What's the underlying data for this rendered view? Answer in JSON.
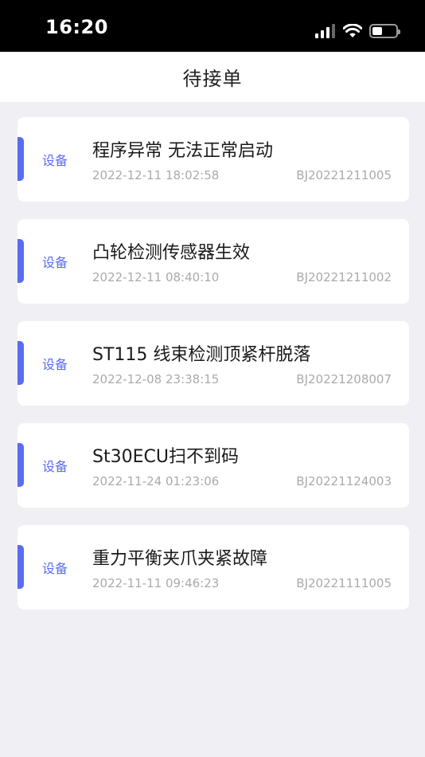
{
  "status_bar": {
    "time": "16:20"
  },
  "nav": {
    "title": "待接单"
  },
  "orders": [
    {
      "tag": "设备",
      "title": "程序异常 无法正常启动",
      "time": "2022-12-11 18:02:58",
      "code": "BJ20221211005"
    },
    {
      "tag": "设备",
      "title": "凸轮检测传感器生效",
      "time": "2022-12-11 08:40:10",
      "code": "BJ20221211002"
    },
    {
      "tag": "设备",
      "title": "ST115 线束检测顶紧杆脱落",
      "time": "2022-12-08 23:38:15",
      "code": "BJ20221208007"
    },
    {
      "tag": "设备",
      "title": "St30ECU扫不到码",
      "time": "2022-11-24 01:23:06",
      "code": "BJ20221124003"
    },
    {
      "tag": "设备",
      "title": "重力平衡夹爪夹紧故障",
      "time": "2022-11-11 09:46:23",
      "code": "BJ20221111005"
    }
  ],
  "colors": {
    "accent": "#5a6cf0",
    "background": "#efeff4"
  }
}
